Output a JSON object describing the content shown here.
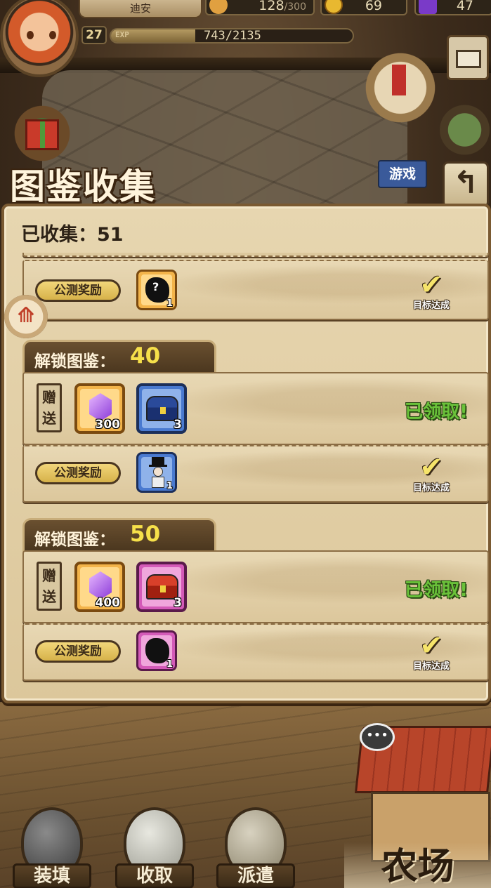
{
  "player": {
    "name": "迪安",
    "level": "27",
    "exp_label": "EXP",
    "exp_text": "743/2135",
    "exp_fraction": 0.348
  },
  "resources": {
    "stamina": {
      "value": "128",
      "max": "/300",
      "icon": "bread-icon"
    },
    "gold": {
      "value": "69",
      "icon": "gold-coin-icon"
    },
    "gems": {
      "value": "47",
      "icon": "purple-gem-icon"
    }
  },
  "side_buttons": {
    "game_label": "游戏"
  },
  "panel": {
    "title": "图鉴收集",
    "collected_label": "已收集：51"
  },
  "groups": [
    {
      "unlock_label": "解锁图鉴：",
      "unlock_count": "40",
      "gift_label": "赠送",
      "rewards": [
        {
          "type": "purple-gem-icon",
          "count": "300",
          "frame": "orange"
        },
        {
          "type": "blue-chest-icon",
          "count": "3",
          "frame": "blue"
        }
      ],
      "status": "已领取!",
      "beta_label": "公测奖励",
      "beta_reward": {
        "type": "gentleman-card-icon",
        "count": "1",
        "frame": "blue"
      },
      "goal_text": "目标达成"
    },
    {
      "unlock_label": "解锁图鉴：",
      "unlock_count": "50",
      "gift_label": "赠送",
      "rewards": [
        {
          "type": "purple-gem-icon",
          "count": "400",
          "frame": "orange"
        },
        {
          "type": "red-chest-icon",
          "count": "3",
          "frame": "pink"
        }
      ],
      "status": "已领取!",
      "beta_label": "公测奖励",
      "beta_reward": {
        "type": "mystery-card-icon",
        "count": "1",
        "frame": "pink"
      },
      "goal_text": "目标达成"
    }
  ],
  "partial_top": {
    "beta_label": "公测奖励",
    "beta_reward": {
      "type": "mystery-card-icon",
      "symbol": "?",
      "count": "1",
      "frame": "orange"
    },
    "goal_text": "目标达成"
  },
  "bottom_buttons": [
    {
      "label": "装填"
    },
    {
      "label": "收取"
    },
    {
      "label": "派遣"
    }
  ],
  "farm": {
    "label": "农场"
  },
  "chat_icon": "•••",
  "back_icon": "↰",
  "check_icon": "✔",
  "scroll_icon": "⟰"
}
